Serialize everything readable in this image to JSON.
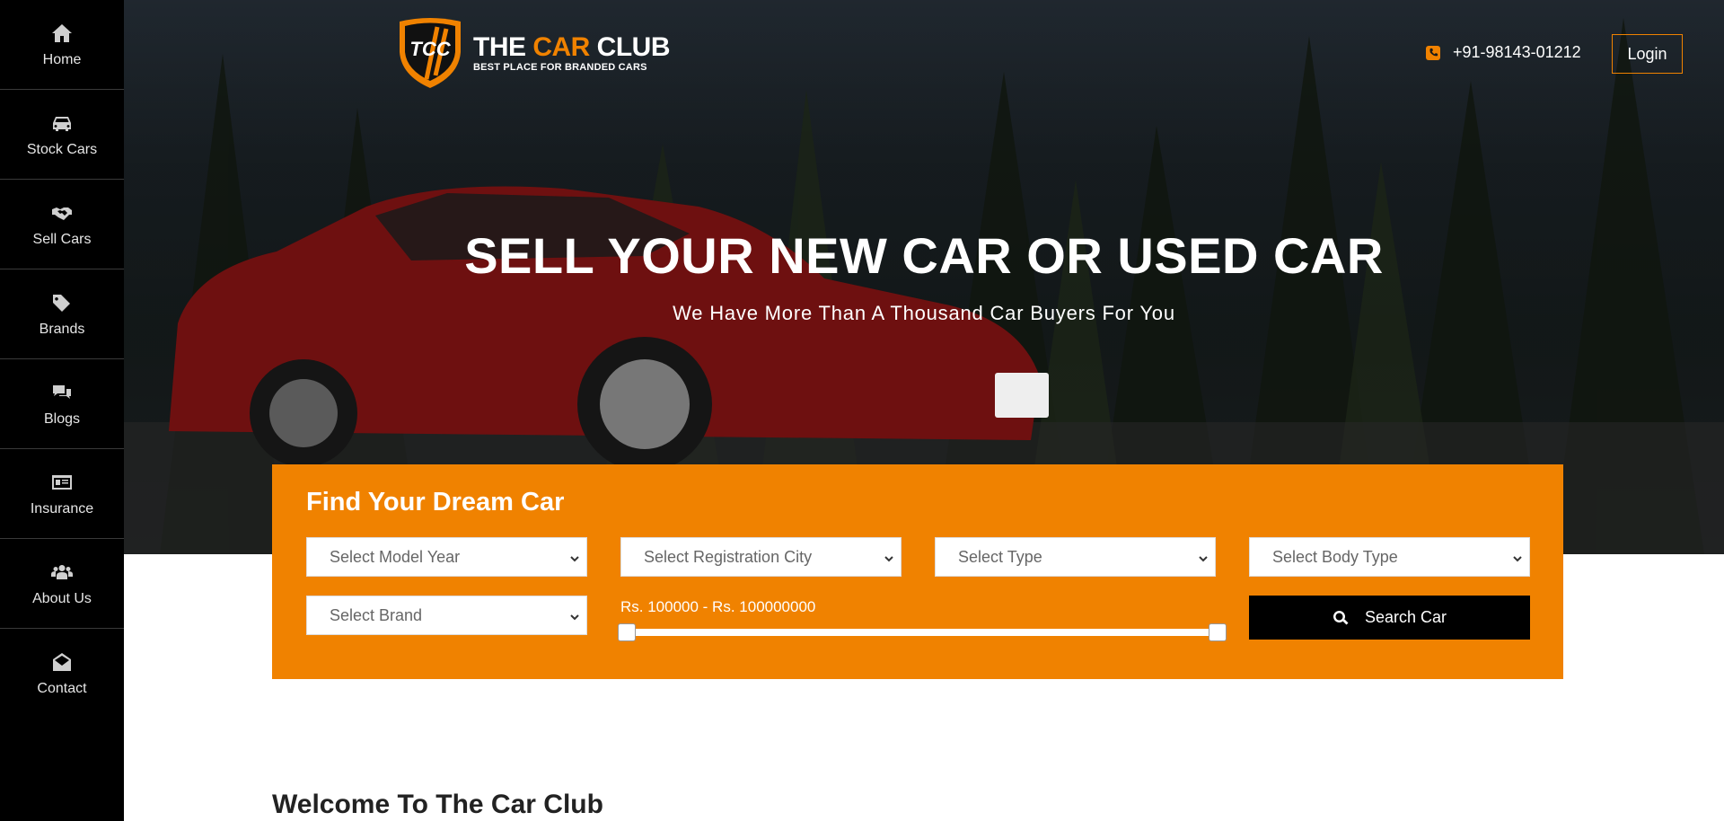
{
  "sidebar": {
    "items": [
      {
        "label": "Home",
        "icon": "home-icon"
      },
      {
        "label": "Stock Cars",
        "icon": "car-icon"
      },
      {
        "label": "Sell Cars",
        "icon": "handshake-icon"
      },
      {
        "label": "Brands",
        "icon": "tags-icon"
      },
      {
        "label": "Blogs",
        "icon": "comments-icon"
      },
      {
        "label": "Insurance",
        "icon": "id-card-icon"
      },
      {
        "label": "About Us",
        "icon": "users-icon"
      },
      {
        "label": "Contact",
        "icon": "envelope-open-icon"
      }
    ]
  },
  "header": {
    "logo_mark": "TCC",
    "logo_title_1": "THE ",
    "logo_title_accent": "CAR",
    "logo_title_2": " CLUB",
    "logo_tagline": "BEST PLACE FOR BRANDED CARS",
    "phone": "+91-98143-01212",
    "login_label": "Login"
  },
  "hero": {
    "title": "SELL YOUR NEW CAR OR USED CAR",
    "subtitle": "We Have More Than A Thousand Car Buyers For You"
  },
  "search": {
    "title": "Find Your Dream Car",
    "model_year": "Select Model Year",
    "registration_city": "Select Registration City",
    "type": "Select Type",
    "body_type": "Select Body Type",
    "brand": "Select Brand",
    "price_range_label": "Rs. 100000 - Rs. 100000000",
    "price_min_fraction": 0.0,
    "price_max_fraction": 1.0,
    "button_label": "Search Car"
  },
  "welcome": {
    "heading": "Welcome To The Car Club"
  },
  "colors": {
    "accent": "#f08200",
    "sidebar": "#000000",
    "button": "#000000"
  }
}
